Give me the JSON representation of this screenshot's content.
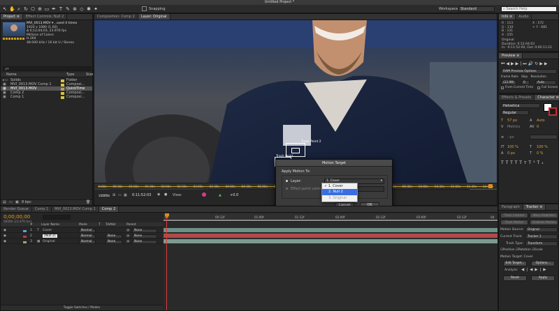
{
  "window": {
    "title": "Untitled Project *"
  },
  "toolbar": {
    "snapping": "Snapping",
    "workspace_label": "Workspace:",
    "workspace_value": "Standard",
    "search_placeholder": "Search Help"
  },
  "project": {
    "tabs": [
      "Project ≡",
      "Effect Controls: Null 2"
    ],
    "thumb_info": [
      "MVI_0013.MOV ▾ , used 4 times",
      "1920 x 1080 (1.00)",
      "Δ 0;12;04;03, 23.976 fps",
      "Millions of Colors",
      "H.264",
      "48.000 kHz / 16 bit U / Stereo"
    ],
    "search_placeholder": "ρ▾",
    "columns": [
      "Name",
      "Type",
      "Size"
    ],
    "items": [
      {
        "name": "Solids",
        "type": "Folder",
        "color": "#d9c23a"
      },
      {
        "name": "MVI_0013.MOV Comp 1",
        "type": "Composi...",
        "color": "#d9c23a"
      },
      {
        "name": "MVI_0013.MOV",
        "type": "QuickTime",
        "color": "#b0a070",
        "selected": true
      },
      {
        "name": "Comp 2",
        "type": "Composi...",
        "color": "#d9c23a"
      },
      {
        "name": "Comp 1",
        "type": "Composi...",
        "color": "#d9c23a"
      }
    ],
    "footer": "8 bpc"
  },
  "viewer": {
    "tabs": [
      "Composition: Comp 2",
      "Layer: Original"
    ],
    "track_point": "Track Point 2",
    "track_point_left": "Track Point",
    "ruler_ticks": [
      "0:00s",
      "00:30s",
      "01:00s",
      "01:30s",
      "02:00s",
      "02:30s",
      "03:00s",
      "03:30s",
      "04:00s",
      "04:30s",
      "05:00s",
      "05:30s",
      "06:00s",
      "06:30s",
      "07:00s",
      "07:30s",
      "08:00s",
      "08:30s",
      "09:00s",
      "09:30s",
      "10:00s",
      "10:30s",
      "11:00s",
      "11:30s",
      "12:00s"
    ],
    "zoom": "(100%)",
    "timecode_a": "0:11:52:03",
    "timecode_b": "0:00:00:00",
    "timecode_c": "0:12:04:02",
    "delta": "+0.0"
  },
  "dialog": {
    "title": "Motion Target",
    "section": "Apply Motion To:",
    "layer_label": "Layer:",
    "layer_value": "1. Cover",
    "effect_label": "Effect point control",
    "options": [
      "1. Cover",
      "2. Null 2",
      "3. Original"
    ],
    "cancel": "Cancel",
    "ok": "OK"
  },
  "info": {
    "tabs": [
      "Info ≡",
      "Audio"
    ],
    "lines_left": [
      "R : 113",
      "G : 110",
      "B : 131",
      "A : 255"
    ],
    "lines_right": [
      "X : 572",
      "+ Y : 681"
    ],
    "meta": [
      "Original",
      "Duration: 0:12:04:03",
      "In: -0:11:52:00, Out: 0:00:11:21"
    ]
  },
  "preview": {
    "tab": "Preview ≡",
    "ram_options": "RAM Preview Options",
    "labels": [
      "Frame Rate",
      "Skip",
      "Resolution"
    ],
    "values": [
      "(23.98)",
      "0",
      "Auto"
    ],
    "from_current": "From Current Time",
    "full_screen": "Full Screen"
  },
  "effects": {
    "tabs": [
      "Effects & Presets",
      "Character ≡"
    ]
  },
  "character": {
    "font": "Helvetica",
    "style": "Regular",
    "size": "57 px",
    "leading": "Auto",
    "kerning": "Metrics",
    "tracking": "0",
    "stroke_unit": "- px",
    "scale_v": "100 %",
    "scale_h": "100 %",
    "baseline": "0 px",
    "tsume": "0 %"
  },
  "timeline": {
    "tabs": [
      "Render Queue",
      "Comp 1",
      "MVI_0013.MOV Comp 1",
      "Comp 2"
    ],
    "timecode": "0;00;00;00",
    "fps": "00000 (23.976 fps)",
    "columns": [
      "#",
      "Layer Name",
      "Mode",
      "T",
      "TrkMat",
      "Parent"
    ],
    "layers": [
      {
        "num": "1",
        "name": "Cover",
        "mode": "Normal",
        "trkmat": "",
        "parent": "None",
        "color": "#6a9fd8",
        "bar": "#6e8f88"
      },
      {
        "num": "2",
        "name": "[Null 2]",
        "mode": "Normal",
        "trkmat": "None",
        "parent": "None",
        "color": "#b84040",
        "bar": "#b04a4a"
      },
      {
        "num": "3",
        "name": "Original",
        "mode": "Normal",
        "trkmat": "None",
        "parent": "None",
        "color": "#b0a070",
        "bar": "#7d9a90"
      }
    ],
    "ruler": [
      "0s",
      "00:12f",
      "01:00f",
      "01:12f",
      "02:00f",
      "02:12f",
      "03:00f",
      "03:12f",
      "04"
    ],
    "footer": "Toggle Switches / Modes"
  },
  "tracker": {
    "tabs": [
      "Paragraph",
      "Tracker ≡"
    ],
    "buttons_row1": [
      "Track Camera",
      "Warp Stabilizer"
    ],
    "buttons_row2": [
      "Track Motion",
      "Stabilize Motion"
    ],
    "motion_source_label": "Motion Source:",
    "motion_source": "Original",
    "current_track_label": "Current Track:",
    "current_track": "Tracker 1",
    "track_type_label": "Track Type:",
    "track_type": "Transform",
    "checks": [
      "Position",
      "Rotation",
      "Scale"
    ],
    "motion_target": "Motion Target: Cover",
    "edit_target": "Edit Target...",
    "options": "Options...",
    "analyze": "Analyze:",
    "reset": "Reset",
    "apply": "Apply"
  }
}
